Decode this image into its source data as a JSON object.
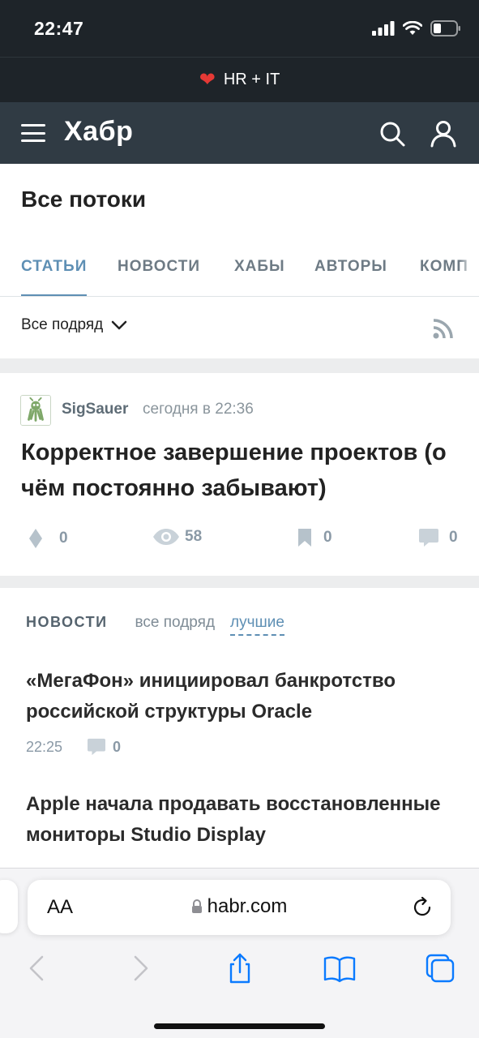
{
  "status_bar": {
    "time": "22:47"
  },
  "banner": {
    "text": "HR + IT"
  },
  "header": {
    "logo": "Хабр"
  },
  "page": {
    "title": "Все потоки"
  },
  "tabs": [
    {
      "label": "СТАТЬИ",
      "active": true
    },
    {
      "label": "НОВОСТИ",
      "active": false
    },
    {
      "label": "ХАБЫ",
      "active": false
    },
    {
      "label": "АВТОРЫ",
      "active": false
    },
    {
      "label": "КОМП",
      "active": false
    }
  ],
  "filter": {
    "label": "Все подряд"
  },
  "article": {
    "author": "SigSauer",
    "time": "сегодня в 22:36",
    "title": "Корректное завершение проектов (о чём постоянно забывают)",
    "rating": "0",
    "views": "58",
    "bookmarks": "0",
    "comments": "0"
  },
  "news": {
    "label": "НОВОСТИ",
    "tabs": [
      {
        "label": "все подряд",
        "active": false
      },
      {
        "label": "лучшие",
        "active": true
      }
    ],
    "items": [
      {
        "title": "«МегаФон» инициировал банкротство российской структуры Oracle",
        "time": "22:25",
        "comments": "0"
      },
      {
        "title": "Apple начала продавать восстановленные мониторы Studio Display"
      }
    ]
  },
  "browser": {
    "text_size_label": "AA",
    "url": "habr.com"
  },
  "colors": {
    "accent": "#5e8fb4",
    "header_bg": "#303b44",
    "status_bg": "#1e2429",
    "ios_blue": "#0a7aff"
  }
}
